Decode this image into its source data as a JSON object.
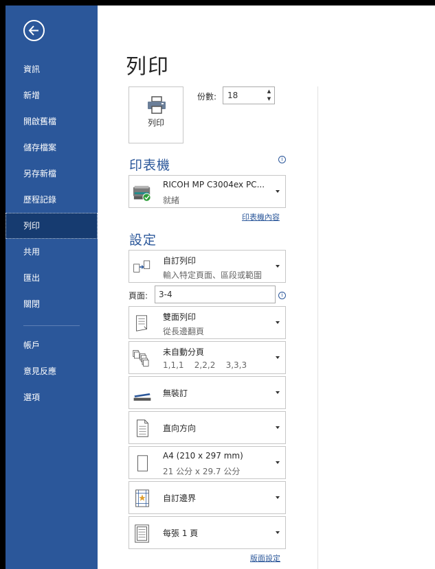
{
  "sidebar": {
    "items": [
      {
        "label": "資訊"
      },
      {
        "label": "新增"
      },
      {
        "label": "開啟舊檔"
      },
      {
        "label": "儲存檔案"
      },
      {
        "label": "另存新檔"
      },
      {
        "label": "歷程記錄"
      },
      {
        "label": "列印"
      },
      {
        "label": "共用"
      },
      {
        "label": "匯出"
      },
      {
        "label": "關閉"
      },
      {
        "label": "帳戶"
      },
      {
        "label": "意見反應"
      },
      {
        "label": "選項"
      }
    ],
    "active": "列印"
  },
  "main": {
    "title": "列印",
    "print_button_label": "列印",
    "copies_label": "份數:",
    "copies_value": "18",
    "printer_heading": "印表機",
    "printer": {
      "name": "RICOH MP C3004ex PC...",
      "status": "就緒",
      "icon": "printer-ready-icon"
    },
    "printer_properties_link": "印表機內容",
    "settings_heading": "設定",
    "settings": {
      "range": {
        "title": "自訂列印",
        "subtitle": "輸入特定頁面、區段或範圍"
      },
      "pages_label": "頁面:",
      "pages_value": "3-4",
      "duplex": {
        "title": "雙面列印",
        "subtitle": "從長邊翻頁"
      },
      "collate": {
        "title": "未自動分頁",
        "subtitle": "1,1,1    2,2,2    3,3,3"
      },
      "staple": {
        "title": "無裝訂"
      },
      "orientation": {
        "title": "直向方向"
      },
      "paper": {
        "title": "A4 (210 x 297 mm)",
        "subtitle": "21 公分 x 29.7 公分"
      },
      "margins": {
        "title": "自訂邊界"
      },
      "pages_per_sheet": {
        "title": "每張 1 頁"
      }
    },
    "page_setup_link": "版面設定"
  },
  "colors": {
    "sidebar_bg": "#2b579a",
    "active_item_bg": "#163b70",
    "accent": "#2b579a"
  }
}
